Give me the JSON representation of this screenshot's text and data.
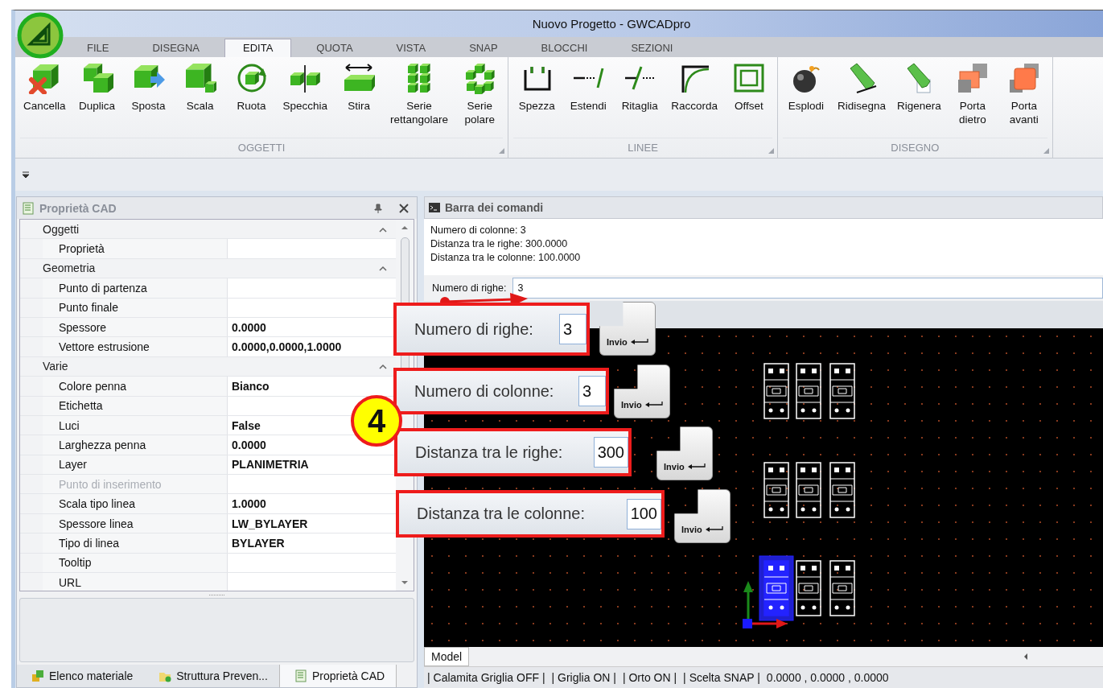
{
  "window": {
    "title": "Nuovo Progetto - GWCADpro"
  },
  "ribbon_tabs": [
    {
      "label": "FILE",
      "selected": false
    },
    {
      "label": "DISEGNA",
      "selected": false
    },
    {
      "label": "EDITA",
      "selected": true
    },
    {
      "label": "QUOTA",
      "selected": false
    },
    {
      "label": "VISTA",
      "selected": false
    },
    {
      "label": "SNAP",
      "selected": false
    },
    {
      "label": "BLOCCHI",
      "selected": false
    },
    {
      "label": "SEZIONI",
      "selected": false
    }
  ],
  "ribbon_groups": [
    {
      "label": "OGGETTI",
      "buttons": [
        {
          "label": "Cancella"
        },
        {
          "label": "Duplica"
        },
        {
          "label": "Sposta"
        },
        {
          "label": "Scala"
        },
        {
          "label": "Ruota"
        },
        {
          "label": "Specchia"
        },
        {
          "label": "Stira"
        },
        {
          "label": "Serie\nrettangolare"
        },
        {
          "label": "Serie\npolare"
        }
      ]
    },
    {
      "label": "LINEE",
      "buttons": [
        {
          "label": "Spezza"
        },
        {
          "label": "Estendi"
        },
        {
          "label": "Ritaglia"
        },
        {
          "label": "Raccorda"
        },
        {
          "label": "Offset"
        }
      ]
    },
    {
      "label": "DISEGNO",
      "buttons": [
        {
          "label": "Esplodi"
        },
        {
          "label": "Ridisegna"
        },
        {
          "label": "Rigenera"
        },
        {
          "label": "Porta\ndietro"
        },
        {
          "label": "Porta\navanti"
        }
      ]
    }
  ],
  "properties_panel": {
    "title": "Proprietà CAD",
    "categories": [
      {
        "name": "Oggetti",
        "expanded": true,
        "rows": [
          {
            "name": "Proprietà",
            "disabled": false
          }
        ]
      },
      {
        "name": "Geometria",
        "expanded": true,
        "rows": [
          {
            "name": "Punto di partenza",
            "disabled": false
          },
          {
            "name": "Punto finale",
            "disabled": false
          },
          {
            "name": "Spessore",
            "value": "0.0000",
            "disabled": false
          },
          {
            "name": "Vettore estrusione",
            "value": "0.0000,0.0000,1.0000",
            "disabled": false
          }
        ]
      },
      {
        "name": "Varie",
        "expanded": true,
        "rows": [
          {
            "name": "Colore penna",
            "value": "Bianco",
            "disabled": false
          },
          {
            "name": "Etichetta",
            "disabled": false
          },
          {
            "name": "Luci",
            "value": "False",
            "disabled": false
          },
          {
            "name": "Larghezza penna",
            "value": "0.0000",
            "disabled": false
          },
          {
            "name": "Layer",
            "value": "PLANIMETRIA",
            "disabled": false
          },
          {
            "name": "Punto di inserimento",
            "disabled": true
          },
          {
            "name": "Scala tipo linea",
            "value": "1.0000",
            "disabled": false
          },
          {
            "name": "Spessore linea",
            "value": "LW_BYLAYER",
            "disabled": false
          },
          {
            "name": "Tipo di linea",
            "value": "BYLAYER",
            "disabled": false
          },
          {
            "name": "Tooltip",
            "disabled": false
          },
          {
            "name": "URL",
            "disabled": false
          }
        ]
      }
    ]
  },
  "bottom_tabs": [
    {
      "label": "Elenco materiale",
      "selected": false
    },
    {
      "label": "Struttura Preven...",
      "selected": false
    },
    {
      "label": "Proprietà CAD",
      "selected": true
    }
  ],
  "command_bar": {
    "title": "Barra dei comandi",
    "history": [
      "Numero di colonne: 3",
      "Distanza tra le righe: 300.0000",
      "Distanza tra le colonne: 100.0000"
    ],
    "prompt": "Numero di righe:",
    "value": "3"
  },
  "canvas": {
    "symbols": [
      {
        "selected": false
      },
      {
        "selected": false
      },
      {
        "selected": false
      },
      {
        "selected": false
      },
      {
        "selected": false
      },
      {
        "selected": false
      },
      {
        "selected": true
      },
      {
        "selected": false
      },
      {
        "selected": false
      }
    ],
    "layout_tab": "Model"
  },
  "status_bar": [
    "| Calamita Griglia OFF |",
    "| Griglia ON |",
    "| Orto ON |",
    "| Scelta SNAP |",
    "0.0000 , 0.0000 , 0.0000"
  ],
  "step_badge": "4",
  "callouts": [
    {
      "label": "Numero di righe:",
      "value": "3",
      "key": "Invio"
    },
    {
      "label": "Numero di colonne:",
      "value": "3",
      "key": "Invio"
    },
    {
      "label": "Distanza tra le righe:",
      "value": "300",
      "key": "Invio"
    },
    {
      "label": "Distanza tra le colonne:",
      "value": "100",
      "key": "Invio"
    }
  ]
}
